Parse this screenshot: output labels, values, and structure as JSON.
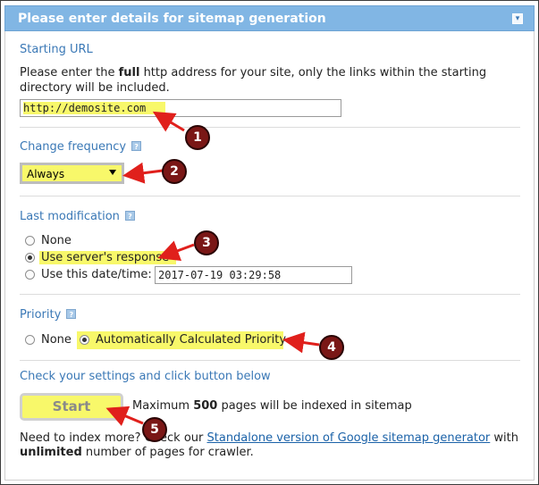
{
  "header": {
    "title": "Please enter details for sitemap generation",
    "collapse_icon": "collapse-down-icon"
  },
  "starting_url": {
    "label": "Starting URL",
    "desc_prefix": "Please enter the ",
    "desc_bold": "full",
    "desc_line1_rest": " http address for your site, only the links within the starting",
    "desc_line2": "directory will be included.",
    "value": "http://demosite.com"
  },
  "change_frequency": {
    "label": "Change frequency",
    "selected": "Always",
    "help_icon": "help-icon"
  },
  "last_modification": {
    "label": "Last modification",
    "options": [
      "None",
      "Use server's response",
      "Use this date/time:"
    ],
    "selected_index": 1,
    "datetime_value": "2017-07-19 03:29:58"
  },
  "priority": {
    "label": "Priority",
    "options": [
      "None",
      "Automatically Calculated Priority"
    ],
    "selected_index": 1
  },
  "submit": {
    "label": "Check your settings and click button below",
    "button": "Start",
    "max_prefix": "Maximum ",
    "max_pages": "500",
    "max_suffix": " pages will be indexed in sitemap"
  },
  "footer": {
    "line1_prefix": "Need to index more? Check our ",
    "link": "Standalone version of Google sitemap generator",
    "line1_suffix": " with",
    "bold": "unlimited",
    "line2_rest": " number of pages for crawler."
  },
  "callouts": [
    "1",
    "2",
    "3",
    "4",
    "5"
  ],
  "colors": {
    "highlight": "#f8f86a",
    "title_bar": "#81b6e4",
    "label": "#3a78b6",
    "callout": "#7a1716",
    "arrow": "#e0201c"
  }
}
